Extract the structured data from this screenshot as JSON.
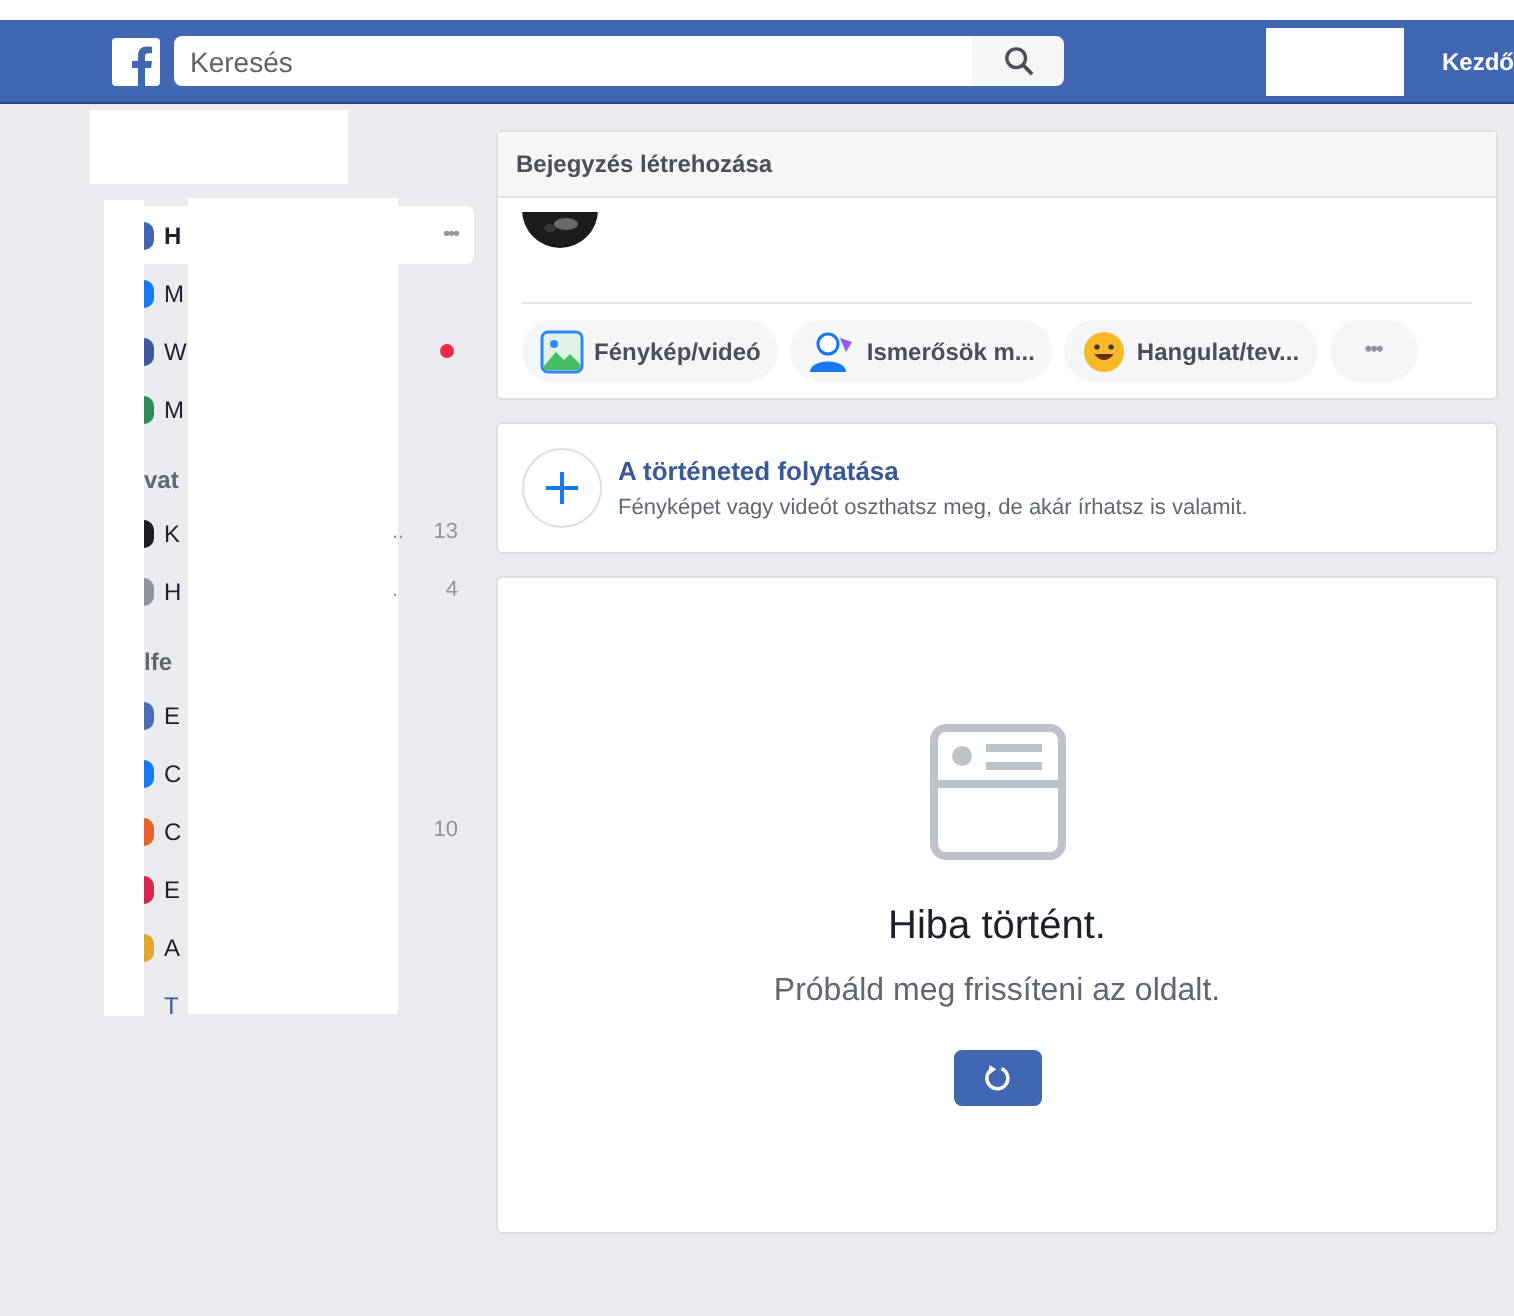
{
  "header": {
    "search": {
      "placeholder": "Keresés"
    },
    "nav_link": "Kezdő"
  },
  "sidebar": {
    "entries": [
      {
        "kind": "item",
        "label": "H",
        "color": "#4267b2",
        "selected": true,
        "unread": false,
        "more": "•••"
      },
      {
        "kind": "item",
        "label": "M",
        "color": "#1877f2",
        "selected": false,
        "unread": false
      },
      {
        "kind": "item",
        "label": "W",
        "color": "#3b5998",
        "selected": false,
        "unread": true
      },
      {
        "kind": "item",
        "label": "M",
        "color": "#2e8b57",
        "selected": false,
        "unread": false
      },
      {
        "kind": "section",
        "label": "vat"
      },
      {
        "kind": "item",
        "label": "K",
        "color": "#1c1e21",
        "selected": false,
        "unread": false,
        "trail": "..",
        "count": "13"
      },
      {
        "kind": "item",
        "label": "H",
        "color": "#8d949e",
        "selected": false,
        "unread": false,
        "trail": ".",
        "count": "4"
      },
      {
        "kind": "section",
        "label": "lfe"
      },
      {
        "kind": "item",
        "label": "E",
        "color": "#4b6cb7",
        "selected": false,
        "unread": false
      },
      {
        "kind": "item",
        "label": "C",
        "color": "#1877f2",
        "selected": false,
        "unread": false
      },
      {
        "kind": "item",
        "label": "C",
        "color": "#e8632b",
        "selected": false,
        "unread": false,
        "count": "10"
      },
      {
        "kind": "item",
        "label": "E",
        "color": "#d6264f",
        "selected": false,
        "unread": false
      },
      {
        "kind": "item",
        "label": "A",
        "color": "#e0a82e",
        "selected": false,
        "unread": false
      },
      {
        "kind": "link",
        "label": "T"
      }
    ]
  },
  "composer": {
    "title": "Bejegyzés létrehozása",
    "actions": [
      {
        "label": "Fénykép/videó"
      },
      {
        "kind": "tag",
        "label": "Ismerősök m..."
      },
      {
        "kind": "feeling",
        "label": "Hangulat/tev..."
      },
      {
        "kind": "more",
        "label": "•••"
      }
    ]
  },
  "story": {
    "title": "A történeted folytatása",
    "subtitle": "Fényképet vagy videót oszthatsz meg, de akár írhatsz is valamit."
  },
  "error": {
    "title": "Hiba történt.",
    "message": "Próbáld meg frissíteni az oldalt."
  }
}
